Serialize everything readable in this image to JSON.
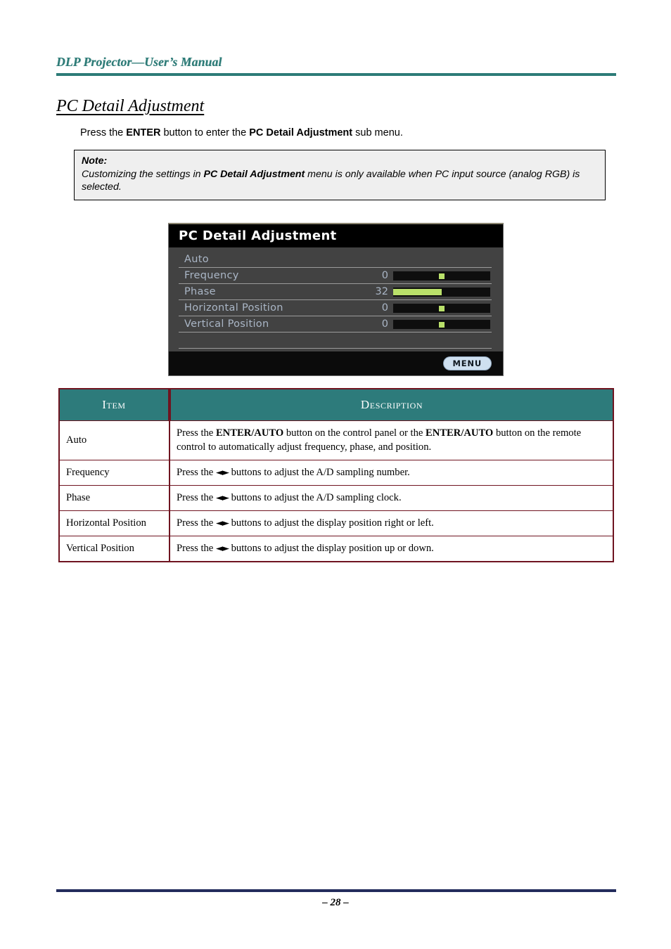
{
  "header": {
    "running_title": "DLP Projector—User’s Manual",
    "rule_color": "#2d7b77"
  },
  "section": {
    "heading": "PC Detail Adjustment"
  },
  "intro": {
    "prefix": "Press the ",
    "bold1": "ENTER",
    "middle": " button to enter the ",
    "bold2": "PC Detail Adjustment",
    "suffix": " sub menu."
  },
  "note": {
    "title": "Note:",
    "body_part1": "Customizing the settings in ",
    "body_bold": "PC Detail Adjustment",
    "body_part2": " menu is only available when PC input source (analog RGB) is selected."
  },
  "osd": {
    "title": "PC Detail Adjustment",
    "accent_color": "#b9e06a",
    "title_bg": "#000000",
    "body_bg": "#424242",
    "label_color": "#aab6c6",
    "menu_button_label": "MENU",
    "rows": [
      {
        "label": "Auto",
        "value": "",
        "has_slider": false
      },
      {
        "label": "Frequency",
        "value": "0",
        "has_slider": true,
        "fill_percent": 0,
        "marker_percent": 50
      },
      {
        "label": "Phase",
        "value": "32",
        "has_slider": true,
        "fill_percent": 50,
        "marker_percent": null
      },
      {
        "label": "Horizontal Position",
        "value": "0",
        "has_slider": true,
        "fill_percent": 0,
        "marker_percent": 50
      },
      {
        "label": "Vertical Position",
        "value": "0",
        "has_slider": true,
        "fill_percent": 0,
        "marker_percent": 50
      }
    ]
  },
  "table": {
    "header_bg": "#2d7b7b",
    "border_color": "#6f1420",
    "columns": [
      "Item",
      "Description"
    ],
    "rows": [
      {
        "item": "Auto",
        "desc_p1": "Press the ",
        "desc_b1": "ENTER/AUTO",
        "desc_p2": " button on the control panel or the ",
        "desc_b2": "ENTER/AUTO",
        "desc_p3": " button on the remote control to automatically adjust frequency, phase, and position."
      },
      {
        "item": "Frequency",
        "desc_p1": "Press the ",
        "arrows": "◄►",
        "desc_p2": " buttons to adjust the A/D sampling number."
      },
      {
        "item": "Phase",
        "desc_p1": "Press the ",
        "arrows": "◄►",
        "desc_p2": " buttons to adjust the A/D sampling clock."
      },
      {
        "item": "Horizontal Position",
        "desc_p1": "Press the ",
        "arrows": "◄►",
        "desc_p2": " buttons to adjust the display position right or left."
      },
      {
        "item": "Vertical Position",
        "desc_p1": "Press the ",
        "arrows": "◄►",
        "desc_p2": " buttons to adjust the display position up or down."
      }
    ]
  },
  "footer": {
    "page_label": "– 28 –",
    "rule_color": "#232c5c"
  }
}
